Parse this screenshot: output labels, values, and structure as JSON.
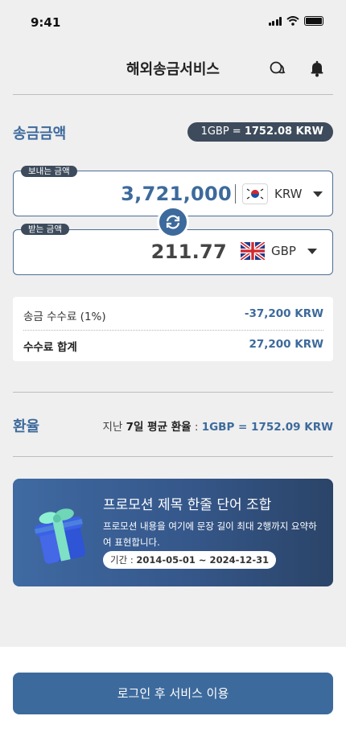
{
  "status": {
    "time": "9:41"
  },
  "header": {
    "title": "해외송금서비스"
  },
  "remit": {
    "label": "송금금액",
    "rate_prefix": "1GBP = ",
    "rate_value": "1752.08 KRW",
    "send": {
      "tag": "보내는 금액",
      "amount": "3,721,000",
      "currency": "KRW"
    },
    "receive": {
      "tag": "받는 금액",
      "amount": "211.77",
      "currency": "GBP"
    }
  },
  "fees": {
    "fee_label": "송금 수수료 (1%)",
    "fee_value": "-37,200 KRW",
    "total_label": "수수료 합계",
    "total_value": "27,200 KRW"
  },
  "exchange": {
    "label": "환율",
    "avg_prefix": "지난 ",
    "avg_days": "7일 평균 환율",
    "avg_sep": " : ",
    "avg_value": "1GBP = 1752.09 KRW"
  },
  "promo": {
    "title": "프로모션 제목 한줄 단어 조합",
    "body": "프로모션 내용을 여기에 문장 길이 최대 2행까지 요약하여 표현합니다.",
    "period_label": "기간 : ",
    "period_value": "2014-05-01 ~ 2024-12-31"
  },
  "cta": {
    "login": "로그인 후 서비스 이용"
  },
  "colors": {
    "accent": "#3d6a9c",
    "dark_pill": "#3d4b5c",
    "background": "#efefef"
  },
  "icons": [
    "signal-icon",
    "wifi-icon",
    "battery-icon",
    "chat-icon",
    "bell-icon",
    "swap-icon",
    "korea-flag-icon",
    "uk-flag-icon",
    "gift-icon",
    "caret-down-icon"
  ]
}
